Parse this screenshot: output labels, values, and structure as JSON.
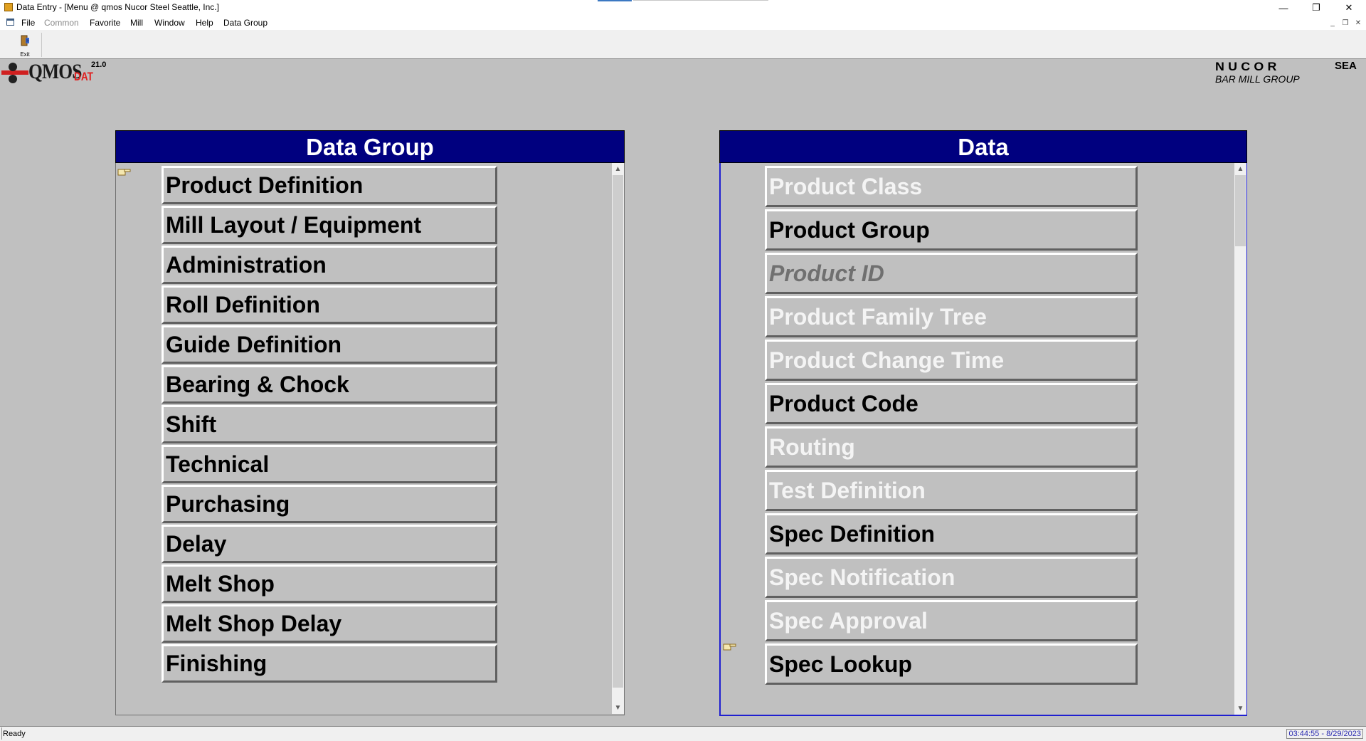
{
  "window": {
    "title": "Data Entry - [Menu  @ qmos Nucor Steel Seattle, Inc.]",
    "minimize_icon": "minimize-icon",
    "maximize_icon": "restore-icon",
    "close_icon": "close-icon"
  },
  "menubar": {
    "items": [
      {
        "label": "File",
        "enabled": true
      },
      {
        "label": "Common",
        "enabled": false
      },
      {
        "label": "Favorite",
        "enabled": true
      },
      {
        "label": "Mill",
        "enabled": true
      },
      {
        "label": "Window",
        "enabled": true
      },
      {
        "label": "Help",
        "enabled": true
      },
      {
        "label": "Data Group",
        "enabled": true
      }
    ]
  },
  "toolbar": {
    "exit_label": "Exit"
  },
  "logo": {
    "name": "QMOS",
    "module": "DAT",
    "version": "21.0"
  },
  "brand": {
    "company": "NUCOR",
    "site": "SEA",
    "division": "BAR MILL GROUP"
  },
  "data_group_panel": {
    "title": "Data Group",
    "items": [
      {
        "label": "Product Definition",
        "state": "enabled"
      },
      {
        "label": "Mill Layout / Equipment",
        "state": "enabled"
      },
      {
        "label": "Administration",
        "state": "enabled"
      },
      {
        "label": "Roll Definition",
        "state": "enabled"
      },
      {
        "label": "Guide Definition",
        "state": "enabled"
      },
      {
        "label": "Bearing & Chock",
        "state": "enabled"
      },
      {
        "label": "Shift",
        "state": "enabled"
      },
      {
        "label": "Technical",
        "state": "enabled"
      },
      {
        "label": "Purchasing",
        "state": "enabled"
      },
      {
        "label": "Delay",
        "state": "enabled"
      },
      {
        "label": "Melt Shop",
        "state": "enabled"
      },
      {
        "label": "Melt Shop Delay",
        "state": "enabled"
      },
      {
        "label": "Finishing",
        "state": "enabled"
      }
    ],
    "selected_index": 0
  },
  "data_panel": {
    "title": "Data",
    "items": [
      {
        "label": "Product Class",
        "state": "disabled"
      },
      {
        "label": "Product Group",
        "state": "enabled"
      },
      {
        "label": "Product ID",
        "state": "italic-gray"
      },
      {
        "label": "Product Family Tree",
        "state": "disabled"
      },
      {
        "label": "Product Change Time",
        "state": "disabled"
      },
      {
        "label": "Product Code",
        "state": "enabled"
      },
      {
        "label": "Routing",
        "state": "disabled"
      },
      {
        "label": "Test Definition",
        "state": "disabled"
      },
      {
        "label": "Spec Definition",
        "state": "enabled"
      },
      {
        "label": "Spec Notification",
        "state": "disabled"
      },
      {
        "label": "Spec Approval",
        "state": "disabled"
      },
      {
        "label": "Spec Lookup",
        "state": "enabled"
      }
    ],
    "selected_index": 11
  },
  "statusbar": {
    "status": "Ready",
    "clock": "03:44:55 - 8/29/2023"
  },
  "colors": {
    "header_bg": "#00007f",
    "panel_bg": "#c0c0c0",
    "active_border": "#1f1fd0",
    "logo_red": "#e02020"
  }
}
